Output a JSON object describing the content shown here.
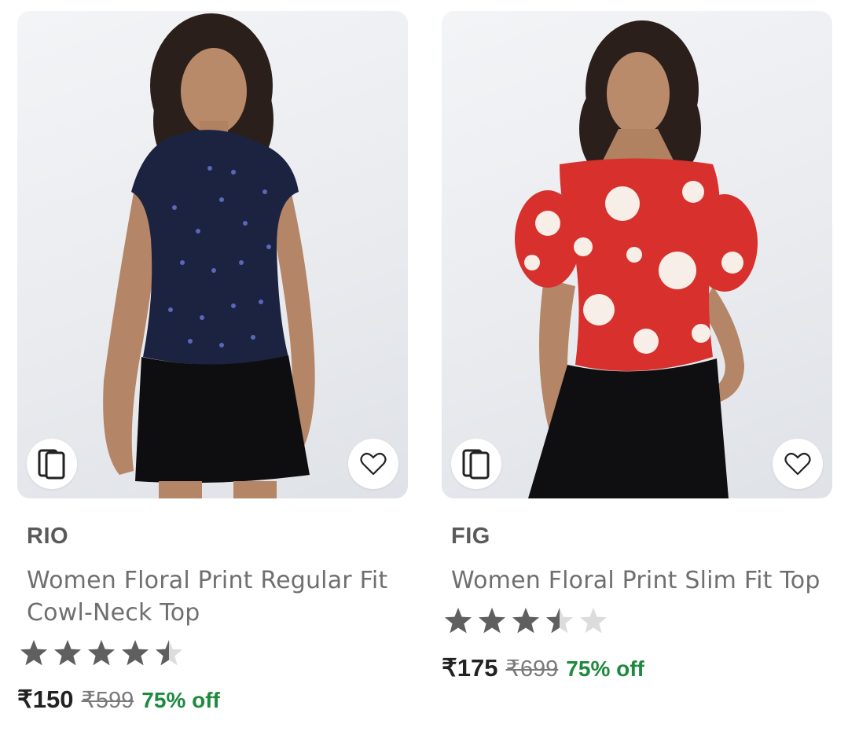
{
  "products": [
    {
      "brand": "RIO",
      "title": "Women Floral Print Regular Fit Cowl-Neck Top",
      "rating": 4.5,
      "price": "₹150",
      "mrp": "₹599",
      "discount": "75% off",
      "image_icon": "model-in-navy-floral-top",
      "similar_icon": "similar-products-icon",
      "wishlist_icon": "heart-outline-icon"
    },
    {
      "brand": "FIG",
      "title": "Women Floral Print Slim Fit Top",
      "rating": 3.5,
      "price": "₹175",
      "mrp": "₹699",
      "discount": "75% off",
      "image_icon": "model-in-red-floral-top",
      "similar_icon": "similar-products-icon",
      "wishlist_icon": "heart-outline-icon"
    }
  ],
  "colors": {
    "discount": "#1d8a3e",
    "star_filled": "#5f5f5f",
    "star_empty": "#dcdcdc",
    "brand": "#5a5a5a",
    "title": "#6f6f6f"
  }
}
